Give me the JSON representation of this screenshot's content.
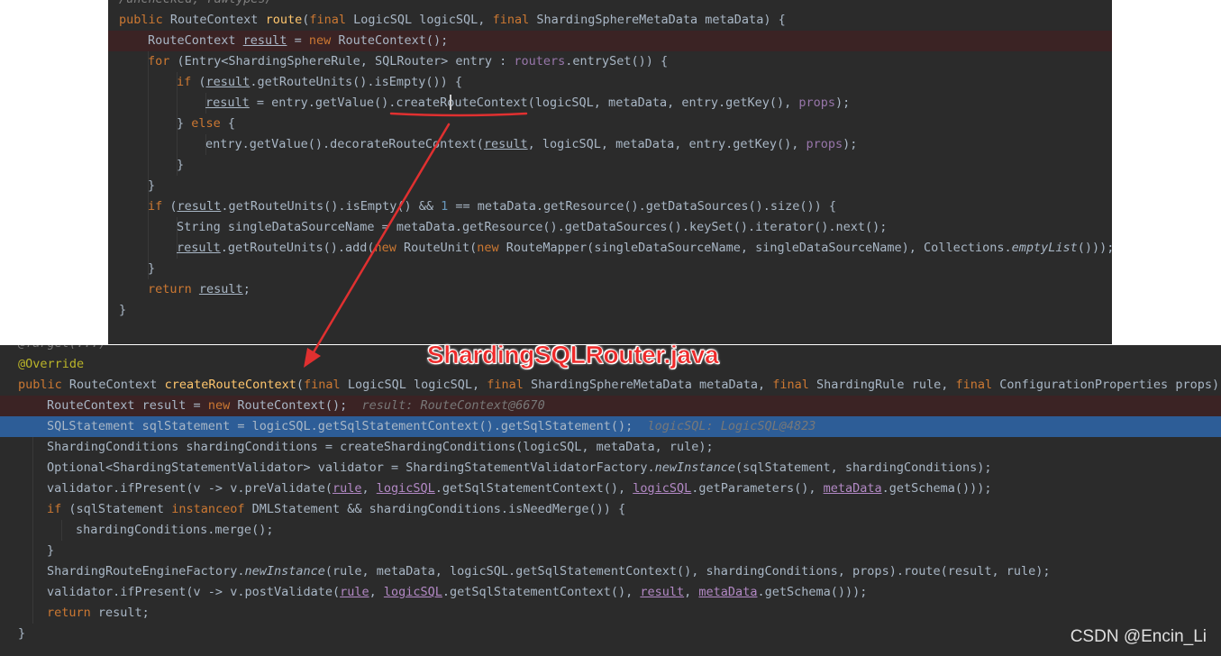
{
  "top_panel": {
    "lines": [
      [
        [
          "cm",
          "/unchecked, rawtypes/"
        ]
      ],
      [
        [
          "kw",
          "public "
        ],
        [
          "pl",
          "RouteContext "
        ],
        [
          "fn",
          "route"
        ],
        [
          "pl",
          "("
        ],
        [
          "kw",
          "final "
        ],
        [
          "pl",
          "LogicSQL logicSQL, "
        ],
        [
          "kw",
          "final "
        ],
        [
          "pl",
          "ShardingSphereMetaData metaData) {"
        ]
      ],
      [
        [
          "pl",
          "RouteContext "
        ],
        [
          "lv",
          "result"
        ],
        [
          "pl",
          " = "
        ],
        [
          "kw",
          "new "
        ],
        [
          "pl",
          "RouteContext();"
        ]
      ],
      [
        [
          "kw",
          "for "
        ],
        [
          "pl",
          "(Entry<ShardingSphereRule, SQLRouter> entry : "
        ],
        [
          "fl",
          "routers"
        ],
        [
          "pl",
          ".entrySet()) {"
        ]
      ],
      [
        [
          "kw",
          "if "
        ],
        [
          "pl",
          "("
        ],
        [
          "lv",
          "result"
        ],
        [
          "pl",
          ".getRouteUnits().isEmpty()) {"
        ]
      ],
      [
        [
          "lv",
          "result"
        ],
        [
          "pl",
          " = entry.getValue()."
        ],
        [
          "pl",
          "createRouteContext"
        ],
        [
          "pl",
          "(logicSQL, metaData, entry.getKey(), "
        ],
        [
          "fl",
          "props"
        ],
        [
          "pl",
          ");"
        ]
      ],
      [
        [
          "pl",
          "} "
        ],
        [
          "kw",
          "else "
        ],
        [
          "pl",
          "{"
        ]
      ],
      [
        [
          "pl",
          "entry.getValue().decorateRouteContext("
        ],
        [
          "lv",
          "result"
        ],
        [
          "pl",
          ", logicSQL, metaData, entry.getKey(), "
        ],
        [
          "fl",
          "props"
        ],
        [
          "pl",
          ");"
        ]
      ],
      [
        [
          "pl",
          "}"
        ]
      ],
      [
        [
          "pl",
          "}"
        ]
      ],
      [
        [
          "kw",
          "if "
        ],
        [
          "pl",
          "("
        ],
        [
          "lv",
          "result"
        ],
        [
          "pl",
          ".getRouteUnits().isEmpty() && "
        ],
        [
          "nm",
          "1"
        ],
        [
          "pl",
          " == metaData.getResource().getDataSources().size()) {"
        ]
      ],
      [
        [
          "pl",
          "String singleDataSourceName = metaData.getResource().getDataSources().keySet().iterator().next();"
        ]
      ],
      [
        [
          "lv",
          "result"
        ],
        [
          "pl",
          ".getRouteUnits().add("
        ],
        [
          "kw",
          "new "
        ],
        [
          "pl",
          "RouteUnit("
        ],
        [
          "kw",
          "new "
        ],
        [
          "pl",
          "RouteMapper(singleDataSourceName, singleDataSourceName), Collections."
        ],
        [
          "it",
          "emptyList"
        ],
        [
          "pl",
          "()));"
        ]
      ],
      [
        [
          "pl",
          "}"
        ]
      ],
      [
        [
          "kw",
          "return "
        ],
        [
          "lv",
          "result"
        ],
        [
          "pl",
          ";"
        ]
      ],
      [
        [
          "pl",
          "}"
        ]
      ]
    ]
  },
  "bottom_panel": {
    "lines": [
      [
        [
          "hi",
          "@Target(...)"
        ]
      ],
      [
        [
          "an",
          "@Override"
        ]
      ],
      [
        [
          "kw",
          "public "
        ],
        [
          "pl",
          "RouteContext "
        ],
        [
          "fn",
          "createRouteContext"
        ],
        [
          "pl",
          "("
        ],
        [
          "kw",
          "final "
        ],
        [
          "pl",
          "LogicSQL logicSQL, "
        ],
        [
          "kw",
          "final "
        ],
        [
          "pl",
          "ShardingSphereMetaData metaData, "
        ],
        [
          "kw",
          "final "
        ],
        [
          "pl",
          "ShardingRule rule, "
        ],
        [
          "kw",
          "final "
        ],
        [
          "pl",
          "ConfigurationProperties props) {"
        ]
      ],
      [
        [
          "pl",
          "RouteContext result = "
        ],
        [
          "kw",
          "new "
        ],
        [
          "pl",
          "RouteContext();  "
        ],
        [
          "hi",
          "result: RouteContext@6670"
        ]
      ],
      [
        [
          "pl",
          "SQLStatement sqlStatement = logicSQL.getSqlStatementContext().getSqlStatement();  "
        ],
        [
          "hi",
          "logicSQL: LogicSQL@4823"
        ]
      ],
      [
        [
          "pl",
          "ShardingConditions shardingConditions = createShardingConditions(logicSQL, metaData, rule);"
        ]
      ],
      [
        [
          "pl",
          "Optional<ShardingStatementValidator> validator = ShardingStatementValidatorFactory."
        ],
        [
          "it",
          "newInstance"
        ],
        [
          "pl",
          "(sqlStatement, shardingConditions);"
        ]
      ],
      [
        [
          "pl",
          "validator.ifPresent(v -> v.preValidate("
        ],
        [
          "pm",
          "rule"
        ],
        [
          "pl",
          ", "
        ],
        [
          "pm",
          "logicSQL"
        ],
        [
          "pl",
          ".getSqlStatementContext(), "
        ],
        [
          "pm",
          "logicSQL"
        ],
        [
          "pl",
          ".getParameters(), "
        ],
        [
          "pm",
          "metaData"
        ],
        [
          "pl",
          ".getSchema()));"
        ]
      ],
      [
        [
          "kw",
          "if "
        ],
        [
          "pl",
          "(sqlStatement "
        ],
        [
          "kw",
          "instanceof "
        ],
        [
          "pl",
          "DMLStatement && shardingConditions.isNeedMerge()) {"
        ]
      ],
      [
        [
          "pl",
          "shardingConditions.merge();"
        ]
      ],
      [
        [
          "pl",
          "}"
        ]
      ],
      [
        [
          "pl",
          "ShardingRouteEngineFactory."
        ],
        [
          "it",
          "newInstance"
        ],
        [
          "pl",
          "(rule, metaData, logicSQL.getSqlStatementContext(), shardingConditions, props).route(result, rule);"
        ]
      ],
      [
        [
          "pl",
          "validator.ifPresent(v -> v.postValidate("
        ],
        [
          "pm",
          "rule"
        ],
        [
          "pl",
          ", "
        ],
        [
          "pm",
          "logicSQL"
        ],
        [
          "pl",
          ".getSqlStatementContext(), "
        ],
        [
          "pm",
          "result"
        ],
        [
          "pl",
          ", "
        ],
        [
          "pm",
          "metaData"
        ],
        [
          "pl",
          ".getSchema()));"
        ]
      ],
      [
        [
          "kw",
          "return "
        ],
        [
          "pl",
          "result;"
        ]
      ],
      [
        [
          "pl",
          "}"
        ]
      ]
    ]
  },
  "file_title": "ShardingSQLRouter.java",
  "watermark": "CSDN @Encin_Li",
  "colors": {
    "editor_bg": "#2b2b2b",
    "keyword": "#cc7832",
    "method_decl": "#ffc66d",
    "field": "#9876aa",
    "execution_line": "#2d5d97",
    "breakpoint_line": "#3b2324",
    "annotation_arrow": "#e03030"
  }
}
